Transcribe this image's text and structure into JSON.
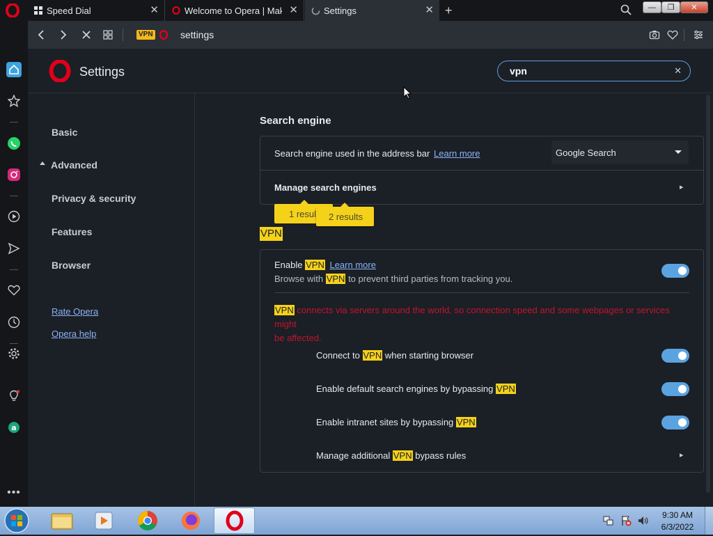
{
  "tabs": [
    {
      "title": "Speed Dial",
      "icon": "grid-icon"
    },
    {
      "title": "Welcome to Opera | Make",
      "icon": "opera-icon"
    },
    {
      "title": "Settings",
      "icon": "loading-icon"
    }
  ],
  "address": {
    "vpn_badge": "VPN",
    "url": "settings"
  },
  "settings": {
    "title": "Settings",
    "search_value": "vpn",
    "nav": {
      "basic": "Basic",
      "advanced": "Advanced",
      "privacy": "Privacy & security",
      "features": "Features",
      "browser": "Browser",
      "rate": "Rate Opera",
      "help": "Opera help"
    }
  },
  "search_engine": {
    "heading": "Search engine",
    "row_label": "Search engine used in the address bar",
    "learn_more": "Learn more",
    "selected": "Google Search",
    "manage": "Manage search engines",
    "bubble1": "1 resul",
    "bubble2": "2 results"
  },
  "vpn": {
    "heading": "VPN",
    "enable_prefix": "Enable",
    "vpn": "VPN",
    "learn_more": "Learn more",
    "desc_prefix": "Browse with",
    "desc_suffix": "to prevent third parties from tracking you.",
    "warning_line1": "connects via servers around the world, so connection speed and some webpages or services might",
    "warning_line2": "be affected.",
    "connect_prefix": "Connect to",
    "connect_suffix": "when starting browser",
    "default_search": "Enable default search engines by bypassing",
    "intranet": "Enable intranet sites by bypassing",
    "bypass_prefix": "Manage additional",
    "bypass_suffix": "bypass rules"
  },
  "taskbar": {
    "time": "9:30 AM",
    "date": "6/3/2022"
  },
  "colors": {
    "accent": "#5ba3e0",
    "highlight": "#f5d21a",
    "warning": "#c0152f",
    "opera_red": "#e0001a"
  }
}
